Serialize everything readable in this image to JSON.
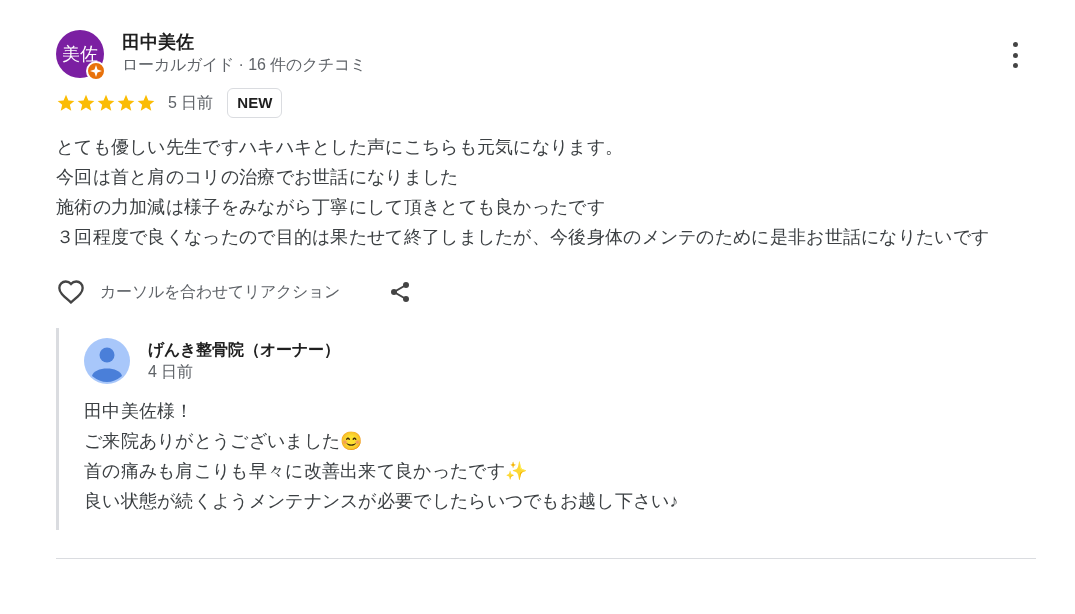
{
  "review": {
    "author": {
      "name": "田中美佐",
      "initials": "美佐",
      "local_guide": true,
      "subtitle": "ローカルガイド · 16 件のクチコミ"
    },
    "stars": 5,
    "time": "5 日前",
    "badge": "NEW",
    "text_lines": [
      "とても優しい先生ですハキハキとした声にこちらも元気になります。",
      "今回は首と肩のコリの治療でお世話になりました",
      "施術の力加減は様子をみながら丁寧にして頂きとても良かったです",
      "３回程度で良くなったので目的は果たせて終了しましたが、今後身体のメンテのために是非お世話になりたいです"
    ],
    "reaction": {
      "label": "カーソルを合わせてリアクション",
      "liked": false
    }
  },
  "owner_reply": {
    "name": "げんき整骨院（オーナー）",
    "time": "4 日前",
    "text_lines": [
      "田中美佐様！",
      "ご来院ありがとうございました😊",
      "首の痛みも肩こりも早々に改善出来て良かったです✨",
      "良い状態が続くようメンテナンスが必要でしたらいつでもお越し下さい♪"
    ]
  }
}
